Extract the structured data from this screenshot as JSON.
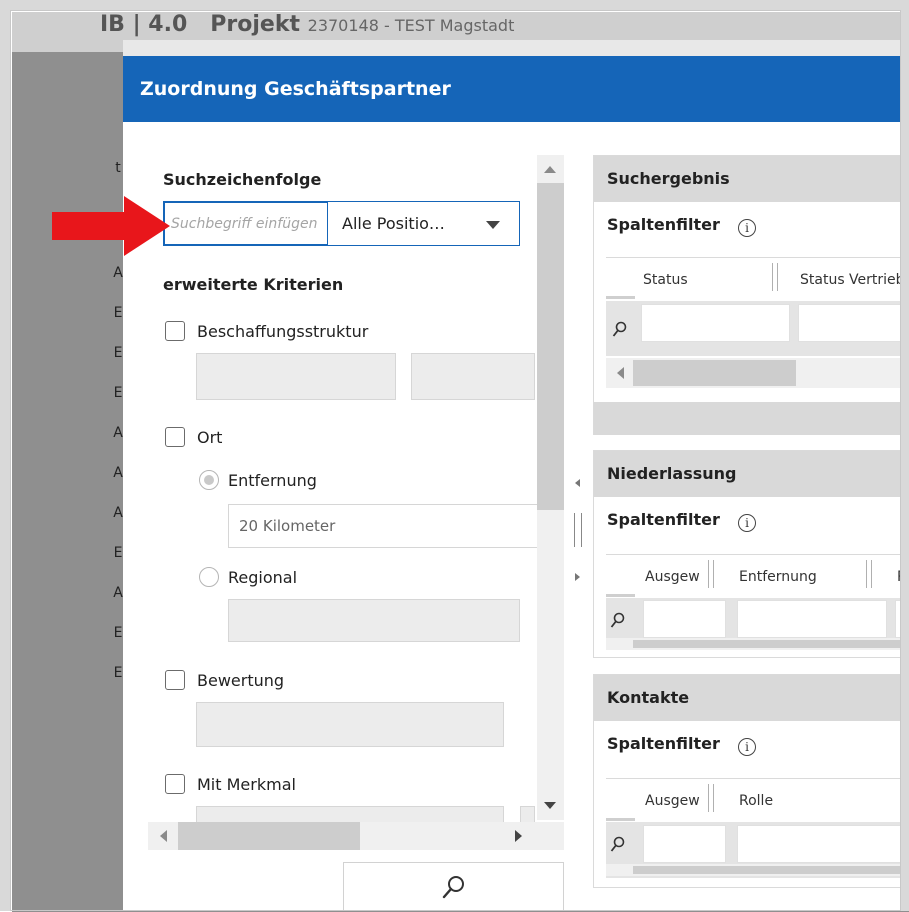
{
  "background_app": {
    "title_fragment": "IB | 4.0",
    "project_label": "Projekt",
    "project_value": "2370148 - TEST Magstadt",
    "side_letters": [
      "t",
      "A",
      "E",
      "E",
      "E",
      "A",
      "A",
      "A",
      "E",
      "A",
      "E",
      "E"
    ]
  },
  "dialog": {
    "title": "Zuordnung Geschäftspartner",
    "title_bar_color": "#1565b8"
  },
  "left_panel": {
    "search_label": "Suchzeichenfolge",
    "search_placeholder": "Suchbegriff einfügen",
    "search_value": "",
    "scope_select_value": "Alle Positio…",
    "extended_label": "erweiterte Kriterien",
    "criteria": {
      "beschaffung_label": "Beschaffungsstruktur",
      "beschaffung_checked": false,
      "ort_label": "Ort",
      "ort_checked": false,
      "entfernung_label": "Entfernung",
      "entfernung_selected": true,
      "entfernung_value": "20 Kilometer",
      "regional_label": "Regional",
      "regional_selected": false,
      "bewertung_label": "Bewertung",
      "bewertung_checked": false,
      "merkmal_label": "Mit Merkmal",
      "merkmal_checked": false
    },
    "search_button_icon": "magnifier-icon"
  },
  "right_panels": {
    "suchergebnis": {
      "title": "Suchergebnis",
      "filter_label": "Spaltenfilter",
      "columns": [
        "Status",
        "Status Vertrieb"
      ]
    },
    "niederlassung": {
      "title": "Niederlassung",
      "filter_label": "Spaltenfilter",
      "columns": [
        "Ausgew",
        "Entfernung",
        "R"
      ]
    },
    "kontakte": {
      "title": "Kontakte",
      "filter_label": "Spaltenfilter",
      "columns": [
        "Ausgew",
        "Rolle"
      ]
    },
    "info_glyph": "i"
  },
  "annotation": {
    "arrow_color": "#e8161b"
  }
}
